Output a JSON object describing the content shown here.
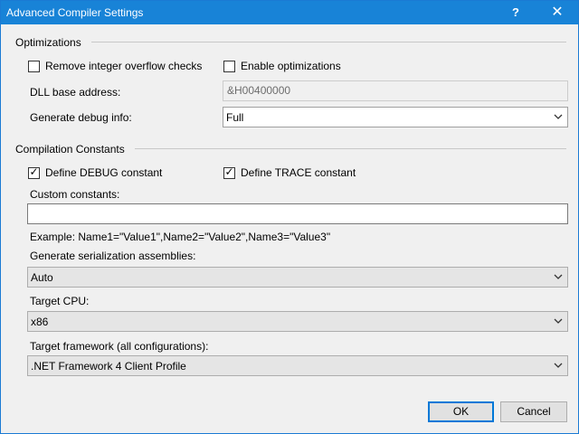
{
  "window": {
    "title": "Advanced Compiler Settings",
    "help_glyph": "?",
    "close_glyph": "✕"
  },
  "optimizations": {
    "heading": "Optimizations",
    "remove_overflow": {
      "label": "Remove integer overflow checks",
      "checked": false
    },
    "enable_optimizations": {
      "label": "Enable optimizations",
      "checked": false
    },
    "dll_base_label": "DLL base address:",
    "dll_base_value": "&H00400000",
    "debug_info_label": "Generate debug info:",
    "debug_info_value": "Full"
  },
  "constants": {
    "heading": "Compilation Constants",
    "define_debug": {
      "label": "Define DEBUG constant",
      "checked": true
    },
    "define_trace": {
      "label": "Define TRACE constant",
      "checked": true
    },
    "custom_label": "Custom constants:",
    "custom_value": "",
    "example": "Example: Name1=\"Value1\",Name2=\"Value2\",Name3=\"Value3\"",
    "serialization_label": "Generate serialization assemblies:",
    "serialization_value": "Auto",
    "target_cpu_label": "Target CPU:",
    "target_cpu_value": "x86",
    "framework_label": "Target framework (all configurations):",
    "framework_value": ".NET Framework 4 Client Profile"
  },
  "buttons": {
    "ok": "OK",
    "cancel": "Cancel"
  },
  "icons": {
    "check": "✓",
    "dropdown": "chevron-down-icon"
  }
}
